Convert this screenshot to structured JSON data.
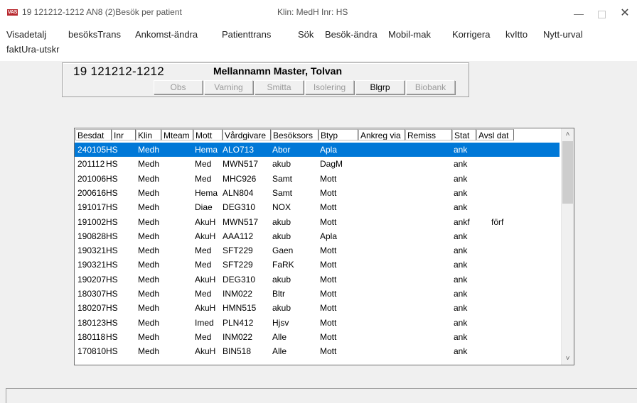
{
  "window": {
    "app_icon": "VAS",
    "title": "19 121212-1212  AN8 (2)Besök per patient",
    "klin": "Klin: MedH  Inr: HS",
    "minimize_glyph": "—",
    "close_glyph": "✕"
  },
  "menu": {
    "items": [
      "Visadetalj",
      "besöksTrans",
      "Ankomst-ändra",
      "Patienttrans",
      "Sök",
      "Besök-ändra",
      "Mobil-mak",
      "Korrigera",
      "kvItto",
      "Nytt-urval",
      "faktUra-utskr"
    ]
  },
  "patient": {
    "pnr": "19 121212-1212",
    "name": "Mellannamn Master, Tolvan",
    "tags": [
      "Obs",
      "Varning",
      "Smitta",
      "Isolering",
      "Blgrp",
      "Biobank"
    ]
  },
  "table": {
    "columns": [
      "Besdat",
      "Inr",
      "Klin",
      "Mteam",
      "Mott",
      "Vårdgivare",
      "Besöksors",
      "Btyp",
      "Ankreg via",
      "Remiss",
      "Stat",
      "Avsl dat"
    ],
    "rows": [
      [
        "240105",
        "HS",
        "Medh",
        "",
        "Hema",
        "ALO713",
        "Abor",
        "Apla",
        "",
        "",
        "ank",
        ""
      ],
      [
        "201112",
        "HS",
        "Medh",
        "",
        "Med",
        "MWN517",
        "akub",
        "DagM",
        "",
        "",
        "ank",
        ""
      ],
      [
        "201006",
        "HS",
        "Medh",
        "",
        "Med",
        "MHC926",
        "Samt",
        "Mott",
        "",
        "",
        "ank",
        ""
      ],
      [
        "200616",
        "HS",
        "Medh",
        "",
        "Hema",
        "ALN804",
        "Samt",
        "Mott",
        "",
        "",
        "ank",
        ""
      ],
      [
        "191017",
        "HS",
        "Medh",
        "",
        "Diae",
        "DEG310",
        "NOX",
        "Mott",
        "",
        "",
        "ank",
        ""
      ],
      [
        "191002",
        "HS",
        "Medh",
        "",
        "AkuH",
        "MWN517",
        "akub",
        "Mott",
        "",
        "",
        "ankf",
        "förf"
      ],
      [
        "190828",
        "HS",
        "Medh",
        "",
        "AkuH",
        "AAA112",
        "akub",
        "Apla",
        "",
        "",
        "ank",
        ""
      ],
      [
        "190321",
        "HS",
        "Medh",
        "",
        "Med",
        "SFT229",
        "Gaen",
        "Mott",
        "",
        "",
        "ank",
        ""
      ],
      [
        "190321",
        "HS",
        "Medh",
        "",
        "Med",
        "SFT229",
        "FaRK",
        "Mott",
        "",
        "",
        "ank",
        ""
      ],
      [
        "190207",
        "HS",
        "Medh",
        "",
        "AkuH",
        "DEG310",
        "akub",
        "Mott",
        "",
        "",
        "ank",
        ""
      ],
      [
        "180307",
        "HS",
        "Medh",
        "",
        "Med",
        "INM022",
        "Bltr",
        "Mott",
        "",
        "",
        "ank",
        ""
      ],
      [
        "180207",
        "HS",
        "Medh",
        "",
        "AkuH",
        "HMN515",
        "akub",
        "Mott",
        "",
        "",
        "ank",
        ""
      ],
      [
        "180123",
        "HS",
        "Medh",
        "",
        "Imed",
        "PLN412",
        "Hjsv",
        "Mott",
        "",
        "",
        "ank",
        ""
      ],
      [
        "180118",
        "HS",
        "Medh",
        "",
        "Med",
        "INM022",
        "Alle",
        "Mott",
        "",
        "",
        "ank",
        ""
      ],
      [
        "170810",
        "HS",
        "Medh",
        "",
        "AkuH",
        "BIN518",
        "Alle",
        "Mott",
        "",
        "",
        "ank",
        ""
      ]
    ],
    "selected_row": 0
  },
  "colors": {
    "selection": "#0078d7",
    "app_icon": "#b8292f"
  },
  "icons": {
    "scroll_up": "chevron-up-icon",
    "scroll_down": "chevron-down-icon"
  }
}
